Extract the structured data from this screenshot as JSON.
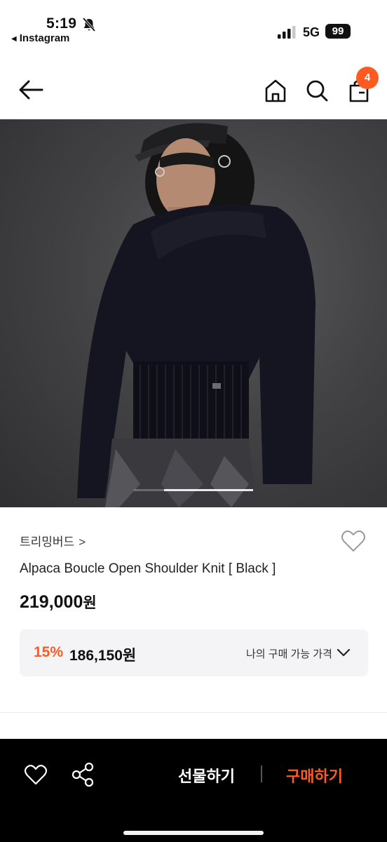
{
  "status_bar": {
    "time": "5:19",
    "back_app": "Instagram",
    "network": "5G",
    "battery": "99"
  },
  "nav": {
    "cart_count": "4",
    "icons": [
      "back-arrow-icon",
      "home-icon",
      "search-icon",
      "shopping-bag-icon"
    ]
  },
  "product": {
    "brand": "트리밍버드",
    "brand_chevron": ">",
    "name": "Alpaca Boucle Open Shoulder Knit [ Black ]",
    "price": "219,000",
    "price_unit": "원",
    "discount_percent": "15%",
    "discount_price": "186,150원",
    "discount_label": "나의 구매 가능 가격"
  },
  "gallery": {
    "image_description_icon": "product-photo"
  },
  "bottom_bar": {
    "gift_label": "선물하기",
    "buy_label": "구매하기"
  },
  "colors": {
    "accent": "#ff5a1f",
    "bottom_bar_bg": "#000000",
    "discount_box_bg": "#f4f4f6"
  }
}
